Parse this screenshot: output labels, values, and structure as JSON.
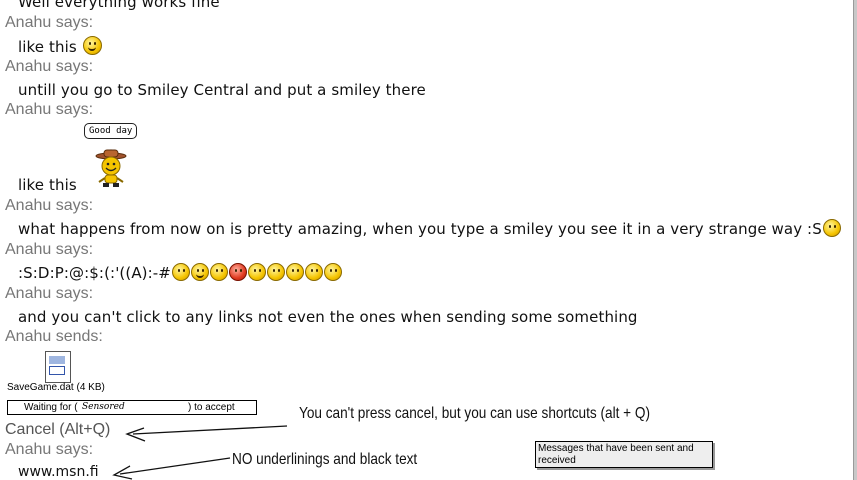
{
  "chat": {
    "line0": "Well everything works fine",
    "says": "Anahu says:",
    "sends": "Anahu sends:",
    "msg1": "like this",
    "msg2": "untill you go to Smiley Central and put a smiley there",
    "msg3": "like this",
    "bubble": "Good day",
    "msg4": "what happens from now on is pretty amazing, when you type a smiley you see it in a very strange way :S",
    "msg5": ":S:D:P:@:$:(:'((A):-#",
    "msg6": "and you can't click to any links not even the ones when sending some something",
    "link": "www.msn.fi"
  },
  "transfer": {
    "file_label": "SaveGame.dat (4 KB)",
    "waiting_prefix": "Waiting for (",
    "contact_name": "Sensored",
    "waiting_suffix": ") to accept",
    "cancel": "Cancel  (Alt+Q)"
  },
  "annotations": {
    "note1": "You can't press cancel, but you can use shortcuts (alt + Q)",
    "note2": "NO underlinings and black text"
  },
  "tooltip": {
    "text": "Messages that have been sent and received"
  },
  "icons": {
    "emoticon": "smiley-icon",
    "cowboy": "cowboy-smiley-icon",
    "file": "file-icon"
  }
}
